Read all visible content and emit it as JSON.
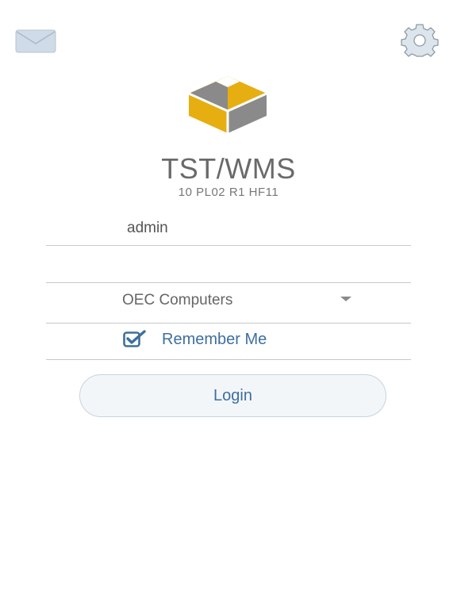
{
  "header": {
    "mail_icon": "envelope-icon",
    "settings_icon": "gear-icon"
  },
  "app": {
    "title": "TST/WMS",
    "version": "10 PL02 R1 HF11",
    "logo_colors": {
      "gold": "#E6AE10",
      "gray": "#8A8A8A"
    }
  },
  "form": {
    "username_value": "admin",
    "password_value": "",
    "company_value": "OEC Computers",
    "remember_label": "Remember Me",
    "remember_checked": true,
    "login_label": "Login"
  },
  "colors": {
    "accent": "#3D6FA0",
    "divider": "#C8C8C8"
  }
}
